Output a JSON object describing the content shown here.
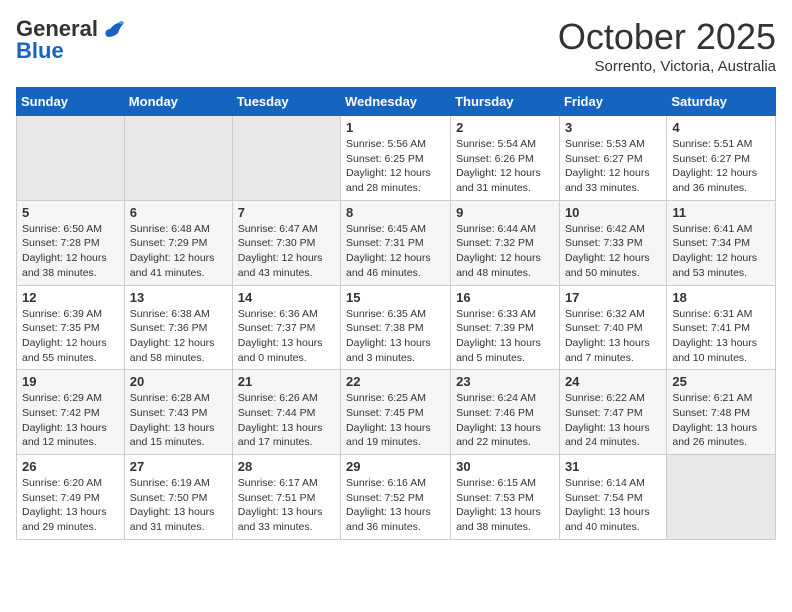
{
  "header": {
    "logo_general": "General",
    "logo_blue": "Blue",
    "month_year": "October 2025",
    "location": "Sorrento, Victoria, Australia"
  },
  "calendar": {
    "days_of_week": [
      "Sunday",
      "Monday",
      "Tuesday",
      "Wednesday",
      "Thursday",
      "Friday",
      "Saturday"
    ],
    "weeks": [
      [
        {
          "day": "",
          "info": ""
        },
        {
          "day": "",
          "info": ""
        },
        {
          "day": "",
          "info": ""
        },
        {
          "day": "1",
          "info": "Sunrise: 5:56 AM\nSunset: 6:25 PM\nDaylight: 12 hours\nand 28 minutes."
        },
        {
          "day": "2",
          "info": "Sunrise: 5:54 AM\nSunset: 6:26 PM\nDaylight: 12 hours\nand 31 minutes."
        },
        {
          "day": "3",
          "info": "Sunrise: 5:53 AM\nSunset: 6:27 PM\nDaylight: 12 hours\nand 33 minutes."
        },
        {
          "day": "4",
          "info": "Sunrise: 5:51 AM\nSunset: 6:27 PM\nDaylight: 12 hours\nand 36 minutes."
        }
      ],
      [
        {
          "day": "5",
          "info": "Sunrise: 6:50 AM\nSunset: 7:28 PM\nDaylight: 12 hours\nand 38 minutes."
        },
        {
          "day": "6",
          "info": "Sunrise: 6:48 AM\nSunset: 7:29 PM\nDaylight: 12 hours\nand 41 minutes."
        },
        {
          "day": "7",
          "info": "Sunrise: 6:47 AM\nSunset: 7:30 PM\nDaylight: 12 hours\nand 43 minutes."
        },
        {
          "day": "8",
          "info": "Sunrise: 6:45 AM\nSunset: 7:31 PM\nDaylight: 12 hours\nand 46 minutes."
        },
        {
          "day": "9",
          "info": "Sunrise: 6:44 AM\nSunset: 7:32 PM\nDaylight: 12 hours\nand 48 minutes."
        },
        {
          "day": "10",
          "info": "Sunrise: 6:42 AM\nSunset: 7:33 PM\nDaylight: 12 hours\nand 50 minutes."
        },
        {
          "day": "11",
          "info": "Sunrise: 6:41 AM\nSunset: 7:34 PM\nDaylight: 12 hours\nand 53 minutes."
        }
      ],
      [
        {
          "day": "12",
          "info": "Sunrise: 6:39 AM\nSunset: 7:35 PM\nDaylight: 12 hours\nand 55 minutes."
        },
        {
          "day": "13",
          "info": "Sunrise: 6:38 AM\nSunset: 7:36 PM\nDaylight: 12 hours\nand 58 minutes."
        },
        {
          "day": "14",
          "info": "Sunrise: 6:36 AM\nSunset: 7:37 PM\nDaylight: 13 hours\nand 0 minutes."
        },
        {
          "day": "15",
          "info": "Sunrise: 6:35 AM\nSunset: 7:38 PM\nDaylight: 13 hours\nand 3 minutes."
        },
        {
          "day": "16",
          "info": "Sunrise: 6:33 AM\nSunset: 7:39 PM\nDaylight: 13 hours\nand 5 minutes."
        },
        {
          "day": "17",
          "info": "Sunrise: 6:32 AM\nSunset: 7:40 PM\nDaylight: 13 hours\nand 7 minutes."
        },
        {
          "day": "18",
          "info": "Sunrise: 6:31 AM\nSunset: 7:41 PM\nDaylight: 13 hours\nand 10 minutes."
        }
      ],
      [
        {
          "day": "19",
          "info": "Sunrise: 6:29 AM\nSunset: 7:42 PM\nDaylight: 13 hours\nand 12 minutes."
        },
        {
          "day": "20",
          "info": "Sunrise: 6:28 AM\nSunset: 7:43 PM\nDaylight: 13 hours\nand 15 minutes."
        },
        {
          "day": "21",
          "info": "Sunrise: 6:26 AM\nSunset: 7:44 PM\nDaylight: 13 hours\nand 17 minutes."
        },
        {
          "day": "22",
          "info": "Sunrise: 6:25 AM\nSunset: 7:45 PM\nDaylight: 13 hours\nand 19 minutes."
        },
        {
          "day": "23",
          "info": "Sunrise: 6:24 AM\nSunset: 7:46 PM\nDaylight: 13 hours\nand 22 minutes."
        },
        {
          "day": "24",
          "info": "Sunrise: 6:22 AM\nSunset: 7:47 PM\nDaylight: 13 hours\nand 24 minutes."
        },
        {
          "day": "25",
          "info": "Sunrise: 6:21 AM\nSunset: 7:48 PM\nDaylight: 13 hours\nand 26 minutes."
        }
      ],
      [
        {
          "day": "26",
          "info": "Sunrise: 6:20 AM\nSunset: 7:49 PM\nDaylight: 13 hours\nand 29 minutes."
        },
        {
          "day": "27",
          "info": "Sunrise: 6:19 AM\nSunset: 7:50 PM\nDaylight: 13 hours\nand 31 minutes."
        },
        {
          "day": "28",
          "info": "Sunrise: 6:17 AM\nSunset: 7:51 PM\nDaylight: 13 hours\nand 33 minutes."
        },
        {
          "day": "29",
          "info": "Sunrise: 6:16 AM\nSunset: 7:52 PM\nDaylight: 13 hours\nand 36 minutes."
        },
        {
          "day": "30",
          "info": "Sunrise: 6:15 AM\nSunset: 7:53 PM\nDaylight: 13 hours\nand 38 minutes."
        },
        {
          "day": "31",
          "info": "Sunrise: 6:14 AM\nSunset: 7:54 PM\nDaylight: 13 hours\nand 40 minutes."
        },
        {
          "day": "",
          "info": ""
        }
      ]
    ]
  }
}
